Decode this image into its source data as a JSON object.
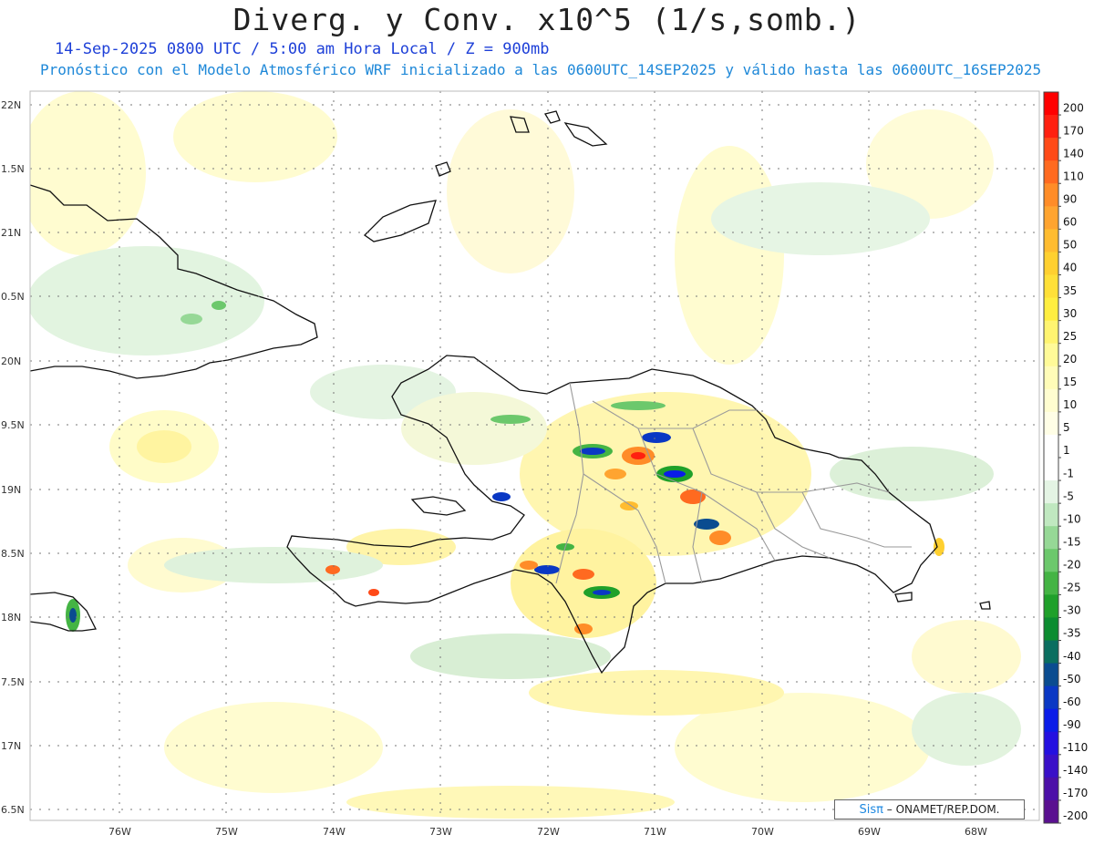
{
  "header": {
    "title": "Diverg. y Conv. x10^5 (1/s,somb.)",
    "subtitle_line1": "14-Sep-2025  0800 UTC / 5:00 am Hora Local / Z = 900mb",
    "subtitle_line2": "Pronóstico con el Modelo Atmosférico WRF inicializado a las 0600UTC_14SEP2025 y válido hasta las  0600UTC_16SEP2025"
  },
  "axes": {
    "lat_labels": [
      "22N",
      "1.5N",
      "21N",
      "0.5N",
      "20N",
      "9.5N",
      "19N",
      "8.5N",
      "18N",
      "7.5N",
      "17N",
      "6.5N"
    ],
    "lon_labels": [
      "76W",
      "75W",
      "74W",
      "73W",
      "72W",
      "71W",
      "70W",
      "69W",
      "68W"
    ]
  },
  "colorbar": {
    "labels": [
      "200",
      "170",
      "140",
      "110",
      "90",
      "60",
      "50",
      "40",
      "35",
      "30",
      "25",
      "20",
      "15",
      "10",
      "5",
      "1",
      "-1",
      "-5",
      "-10",
      "-15",
      "-20",
      "-25",
      "-30",
      "-35",
      "-40",
      "-50",
      "-60",
      "-90",
      "-110",
      "-140",
      "-170",
      "-200"
    ],
    "colors": [
      "#ff0000",
      "#ff2010",
      "#ff4a18",
      "#ff6a20",
      "#ff8c28",
      "#ffa430",
      "#ffbc30",
      "#ffd030",
      "#ffe038",
      "#ffee40",
      "#fff470",
      "#fffa98",
      "#fffcb8",
      "#fffdd0",
      "#fffee6",
      "#ffffff",
      "#ffffff",
      "#e4f4e4",
      "#c0e8c0",
      "#96d896",
      "#6cc86c",
      "#44b444",
      "#1fa02a",
      "#0c8c30",
      "#0a6e60",
      "#0a4c90",
      "#0a38c4",
      "#0a1ce8",
      "#2410e0",
      "#3a10c8",
      "#4c10a8",
      "#5a1090"
    ]
  },
  "credit": {
    "logo": "Sisπ",
    "text": "– ONAMET/REP.DOM."
  }
}
